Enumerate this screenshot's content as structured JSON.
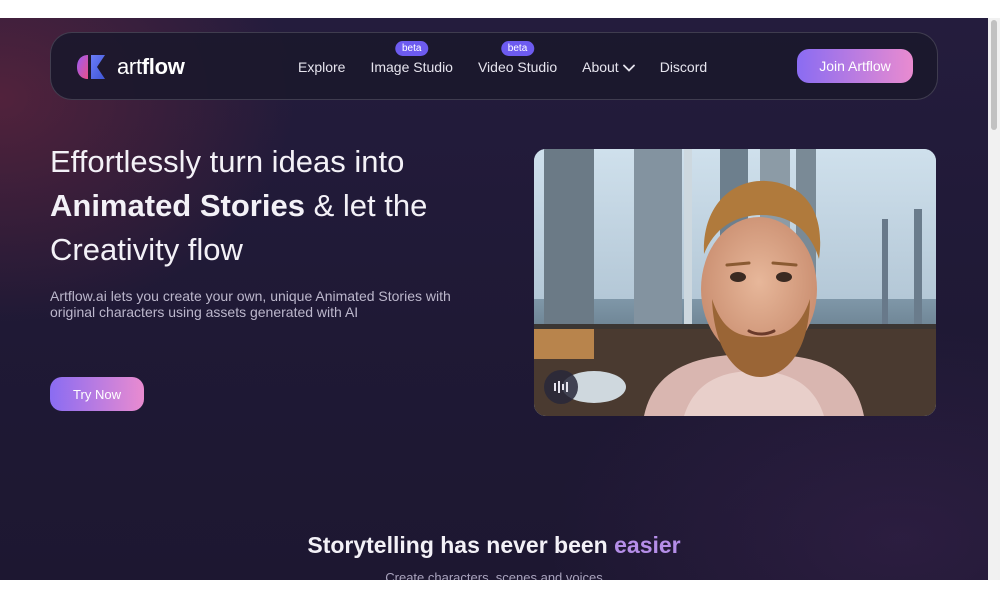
{
  "brand": {
    "name_light": "art",
    "name_bold": "flow",
    "colors": {
      "accent_start": "#8a6cf2",
      "accent_end": "#e98bd0",
      "badge": "#6d5bf0",
      "highlight": "#b58ee8"
    }
  },
  "nav": {
    "items": [
      {
        "label": "Explore"
      },
      {
        "label": "Image Studio",
        "badge": "beta"
      },
      {
        "label": "Video Studio",
        "badge": "beta"
      },
      {
        "label": "About",
        "icon": "chevron-down-icon"
      },
      {
        "label": "Discord"
      }
    ],
    "cta": "Join Artflow"
  },
  "hero": {
    "line1": "Effortlessly turn ideas into",
    "line2_strong": "Animated Stories",
    "line2_rest": " & let the",
    "line3": "Creativity flow",
    "description": "Artflow.ai lets you create your own, unique Animated Stories with original characters using assets generated with AI",
    "cta": "Try Now",
    "video_icon": "audio-wave-icon"
  },
  "section": {
    "title_main": "Storytelling has never been ",
    "title_accent": "easier",
    "subtitle": "Create characters, scenes and voices"
  }
}
